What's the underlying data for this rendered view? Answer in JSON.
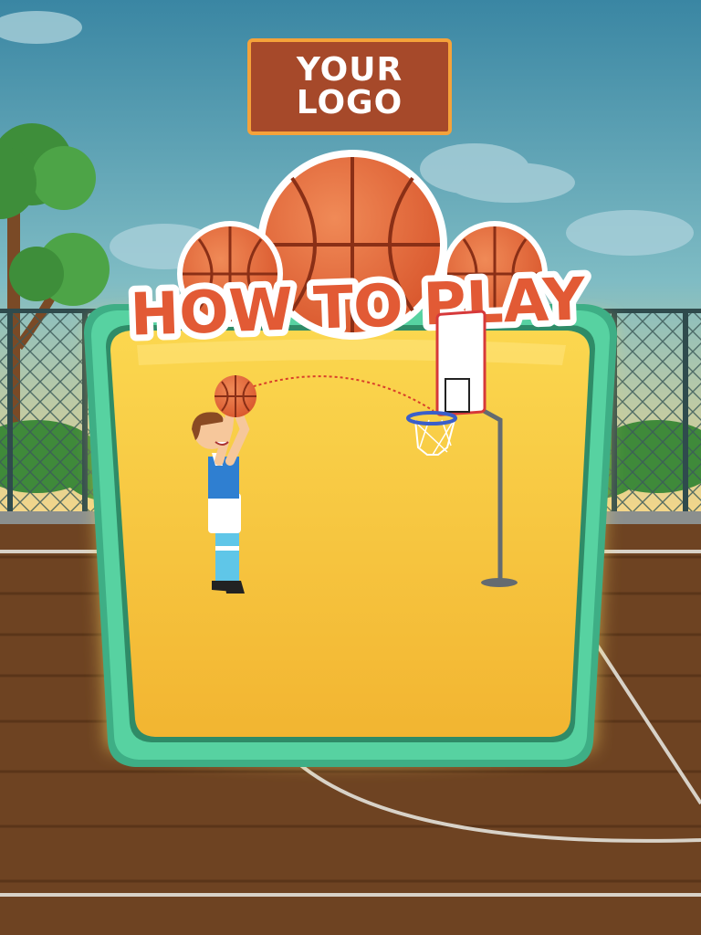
{
  "logo": {
    "line1": "YOUR",
    "line2": "LOGO"
  },
  "title": "HOW TO PLAY",
  "colors": {
    "sky": "#3d8fae",
    "court": "#6e4322",
    "panel_border": "#4cc193",
    "panel_fill": "#f6c33e",
    "title_text": "#e25a35",
    "logo_bg": "#a6492a",
    "logo_border": "#f5a23a"
  },
  "icons": [
    "basketball-icon",
    "player-icon",
    "hoop-icon"
  ]
}
